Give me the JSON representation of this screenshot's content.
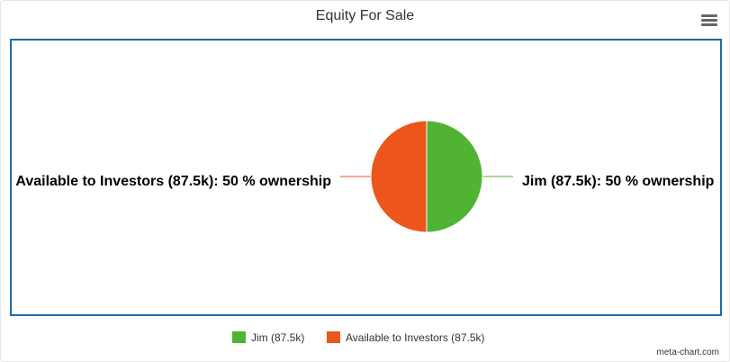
{
  "chart_data": {
    "type": "pie",
    "title": "Equity For Sale",
    "categories": [
      "Jim (87.5k)",
      "Available to Investors (87.5k)"
    ],
    "values": [
      50,
      50
    ],
    "colors": [
      "#50b432",
      "#ed561b"
    ],
    "data_labels": [
      "Jim (87.5k): 50 % ownership",
      "Available to Investors (87.5k): 50 % ownership"
    ],
    "legend": {
      "placement": "bottom-center",
      "items": [
        "Jim (87.5k)",
        "Available to Investors (87.5k)"
      ]
    }
  },
  "ui": {
    "menu_icon": "hamburger-menu-icon",
    "plot_border_color": "#1b6aa8",
    "credit": "meta-chart.com"
  }
}
